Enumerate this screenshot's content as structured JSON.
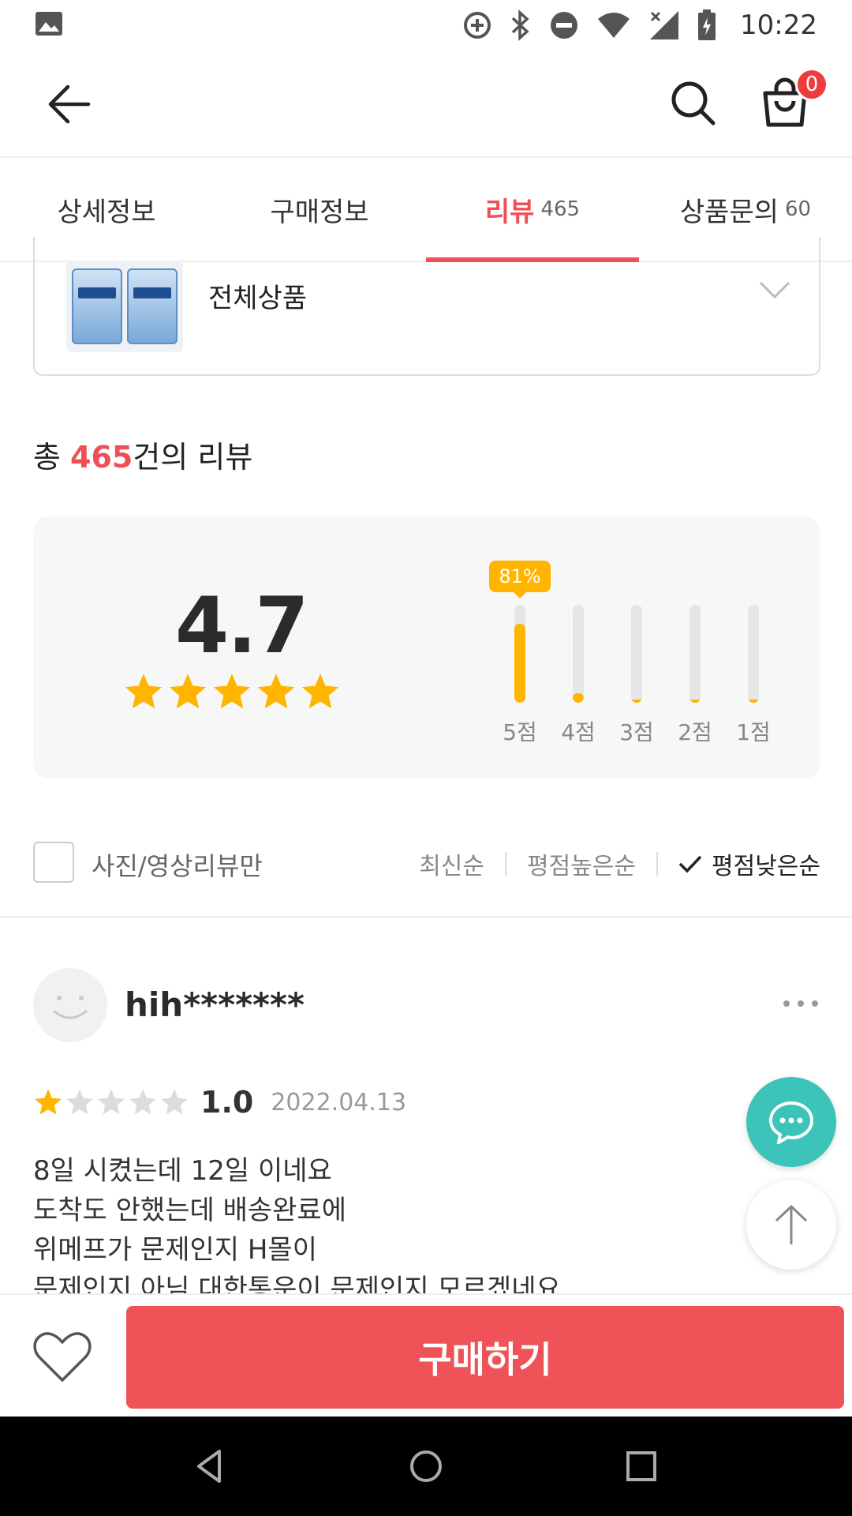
{
  "status_bar": {
    "time": "10:22",
    "icons": [
      "image-icon",
      "data-saver-icon",
      "bluetooth-icon",
      "do-not-disturb-icon",
      "wifi-icon",
      "signal-icon",
      "battery-charging-icon"
    ]
  },
  "header": {
    "cart_count": "0"
  },
  "tabs": [
    {
      "label": "상세정보",
      "count": ""
    },
    {
      "label": "구매정보",
      "count": ""
    },
    {
      "label": "리뷰",
      "count": "465",
      "active": true
    },
    {
      "label": "상품문의",
      "count": "60"
    }
  ],
  "product_selector": {
    "label": "전체상품"
  },
  "summary": {
    "prefix": "총 ",
    "count": "465",
    "suffix": "건의 리뷰"
  },
  "rating": {
    "average": "4.7",
    "stars_filled": 5,
    "top_percent_label": "81%",
    "distribution": [
      {
        "label": "5점",
        "fraction": 0.81
      },
      {
        "label": "4점",
        "fraction": 0.1
      },
      {
        "label": "3점",
        "fraction": 0.03
      },
      {
        "label": "2점",
        "fraction": 0.01
      },
      {
        "label": "1점",
        "fraction": 0.01
      }
    ],
    "colors": {
      "star": "#ffb400",
      "track": "#e6e6e6"
    }
  },
  "filters": {
    "photo_only_label": "사진/영상리뷰만",
    "sort_newest": "최신순",
    "sort_high": "평점높은순",
    "sort_low": "평점낮은순",
    "selected_sort": "평점낮은순"
  },
  "review": {
    "username": "hih*******",
    "stars": 1,
    "score": "1.0",
    "date": "2022.04.13",
    "lines": [
      "8일 시켰는데 12일 이네요",
      "도착도 안했는데 배송완료에",
      "위메프가 문제인지 H몰이",
      "문제인지 아님 대한통운이 문제인지 모르겠네요"
    ]
  },
  "purchase": {
    "buy_label": "구매하기"
  },
  "brand_colors": {
    "accent": "#ef4f55",
    "chat": "#3cc3ba"
  }
}
